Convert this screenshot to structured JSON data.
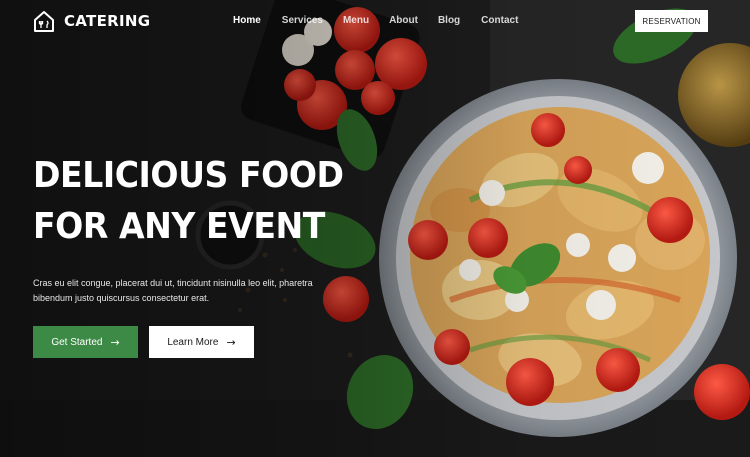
{
  "brand": {
    "name": "CATERING",
    "logo_icon": "house-utensils-icon"
  },
  "nav": {
    "items": [
      {
        "label": "Home",
        "active": true
      },
      {
        "label": "Services",
        "active": false
      },
      {
        "label": "Menu",
        "active": false
      },
      {
        "label": "About",
        "active": false
      },
      {
        "label": "Blog",
        "active": false
      },
      {
        "label": "Contact",
        "active": false
      }
    ]
  },
  "header": {
    "reservation_label": "RESERVATION"
  },
  "hero": {
    "headline_line1": "DELICIOUS FOOD",
    "headline_line2": "FOR ANY EVENT",
    "subtext": "Cras eu elit congue, placerat dui ut, tincidunt nisinulla leo elit, pharetra bibendum justo quiscursus consectetur erat.",
    "primary_button": "Get Started",
    "secondary_button": "Learn More",
    "button_icon": "arrow-right-icon"
  },
  "colors": {
    "accent": "#3c8a45",
    "text": "#ffffff",
    "background": "#1b1b1b"
  }
}
